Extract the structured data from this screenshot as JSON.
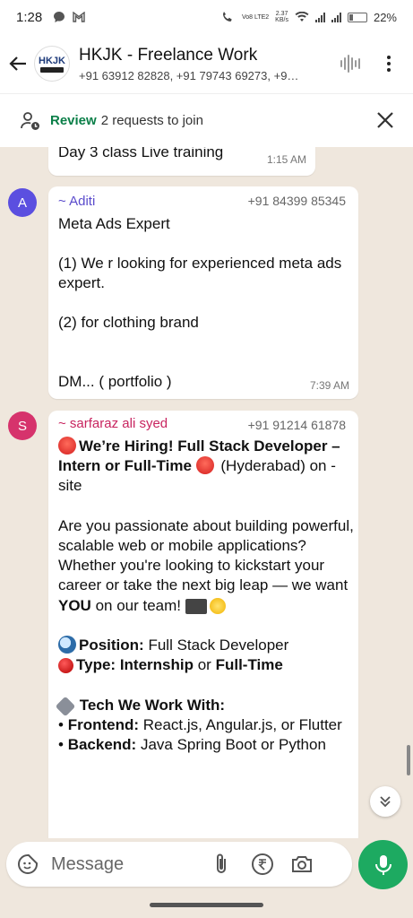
{
  "status_bar": {
    "time": "1:28",
    "network_speed_top": "2.37",
    "network_speed_unit": "KB/s",
    "volte_label": "Vo8 LTE2",
    "battery": "22%"
  },
  "header": {
    "avatar_text": "HKJK",
    "title": "HKJK - Freelance Work",
    "subtitle": "+91 63912 82828, +91 79743 69273, +9…"
  },
  "review_bar": {
    "label": "Review",
    "text": "2 requests to join"
  },
  "messages": [
    {
      "text": "Day 3 class Live training",
      "time": "1:15 AM"
    },
    {
      "avatar_letter": "A",
      "avatar_color": "#5b4fe0",
      "sender": "~ Aditi",
      "phone": "+91 84399 85345",
      "text": "Meta Ads Expert\n\n(1) We r looking for experienced meta ads expert.\n\n(2) for clothing brand\n\n\nDM... ( portfolio )",
      "time": "7:39 AM"
    },
    {
      "avatar_letter": "S",
      "avatar_color": "#d6336c",
      "sender": "~ sarfaraz ali syed",
      "phone": "+91 91214 61878",
      "headline": "We’re Hiring! Full Stack Developer – Intern or Full-Time",
      "location": "(Hyderabad) on - site",
      "intro_1": "Are you passionate about building powerful, scalable web or mobile applications? Whether you're looking to kickstart your career or take the next big leap — we want",
      "intro_you": "YOU",
      "intro_2": "on our team!",
      "position_label": "Position:",
      "position_value": "Full Stack Developer",
      "type_label": "Type:",
      "type_value_1": "Internship",
      "type_or": "or",
      "type_value_2": "Full-Time",
      "tech_heading": "Tech We Work With:",
      "frontend_label": "Frontend:",
      "frontend_value": "React.js, Angular.js, or Flutter",
      "backend_label": "Backend:",
      "backend_value": "Java Spring Boot or Python"
    }
  ],
  "composer": {
    "placeholder": "Message"
  },
  "icons": {
    "back": "arrow-left-icon",
    "audio": "waveform-icon",
    "menu": "more-vertical-icon",
    "review": "people-clock-icon",
    "close": "close-icon",
    "jump": "chevron-double-down-icon",
    "sticker": "sticker-icon",
    "attach": "paperclip-icon",
    "payment": "rupee-icon",
    "camera": "camera-icon",
    "mic": "mic-icon"
  },
  "colors": {
    "accent_green": "#1daa61",
    "review_green": "#0a7f48",
    "chat_background": "#efe7dd"
  }
}
